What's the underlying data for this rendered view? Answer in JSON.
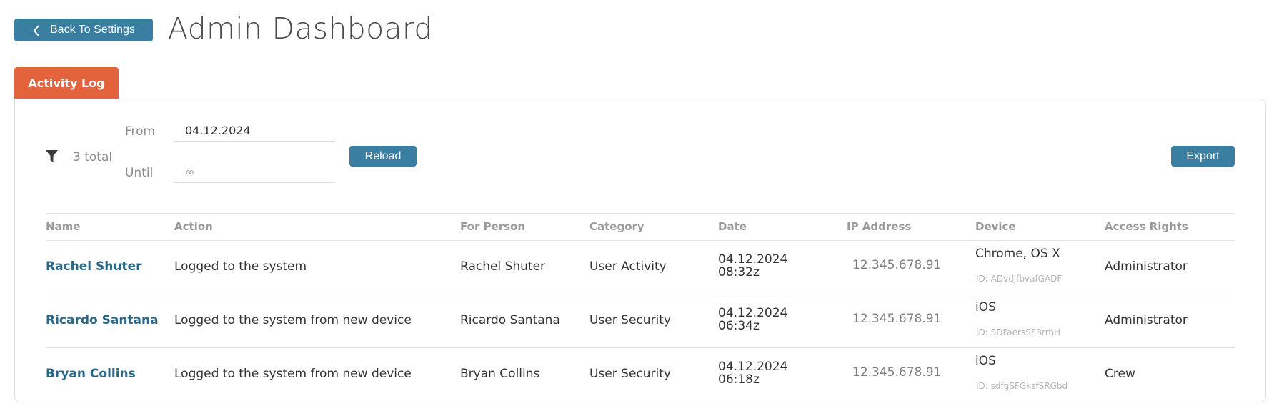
{
  "header": {
    "back_label": "Back To Settings",
    "title": "Admin Dashboard"
  },
  "tabs": {
    "active_label": "Activity Log"
  },
  "filter": {
    "total_text": "3 total",
    "from_label": "From",
    "from_value": "04.12.2024",
    "until_label": "Until",
    "until_placeholder": "∞",
    "reload_label": "Reload",
    "export_label": "Export"
  },
  "table": {
    "columns": [
      "Name",
      "Action",
      "For Person",
      "Category",
      "Date",
      "IP Address",
      "Device",
      "Access Rights"
    ],
    "rows": [
      {
        "name": "Rachel Shuter",
        "action": "Logged to the system",
        "person": "Rachel Shuter",
        "category": "User Activity",
        "date": "04.12.2024",
        "time": "08:32z",
        "ip": "12.345.678.91",
        "device": "Chrome, OS X",
        "device_id": "ID: ADvdjfbvafGADF",
        "rights": "Administrator"
      },
      {
        "name": "Ricardo Santana",
        "action": "Logged to the system from new device",
        "person": "Ricardo Santana",
        "category": "User Security",
        "date": "04.12.2024",
        "time": "06:34z",
        "ip": "12.345.678.91",
        "device": "iOS",
        "device_id": "ID: SDFaersSFBrrhH",
        "rights": "Administrator"
      },
      {
        "name": "Bryan Collins",
        "action": "Logged to the system from new device",
        "person": "Bryan Collins",
        "category": "User Security",
        "date": "04.12.2024",
        "time": "06:18z",
        "ip": "12.345.678.91",
        "device": "iOS",
        "device_id": "ID: sdfgSFGksfSRGbd",
        "rights": "Crew"
      }
    ]
  },
  "colors": {
    "accent_blue": "#3a7ea1",
    "tab_orange": "#e3643c",
    "link_blue": "#2b6888"
  },
  "icons": {
    "back": "chevron-left-icon",
    "filter": "filter-icon"
  }
}
